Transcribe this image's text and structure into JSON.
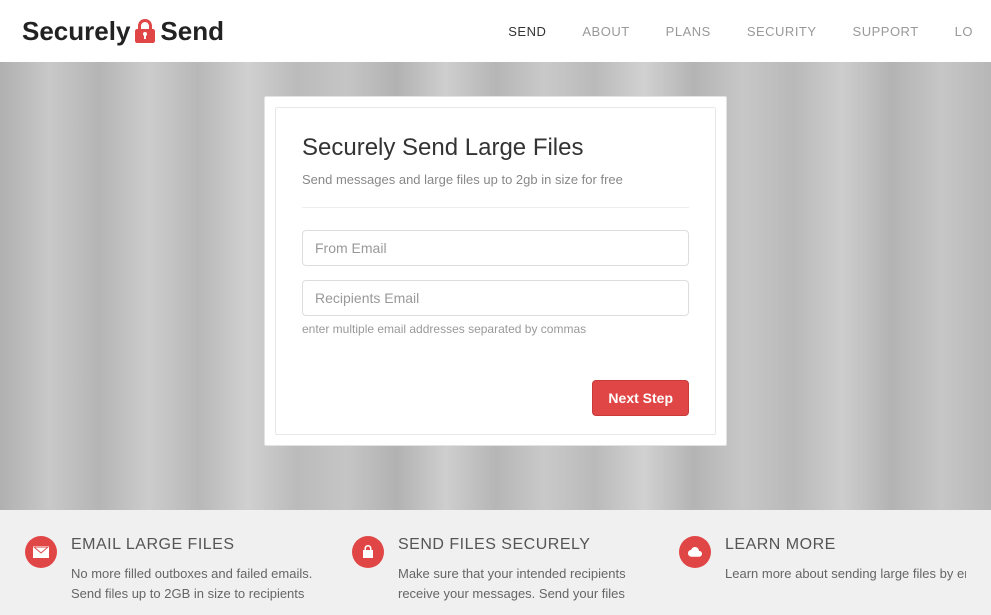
{
  "brand": {
    "part1": "Securely",
    "part2": "Send",
    "accent": "#e14646"
  },
  "nav": {
    "items": [
      {
        "label": "SEND",
        "active": true
      },
      {
        "label": "ABOUT",
        "active": false
      },
      {
        "label": "PLANS",
        "active": false
      },
      {
        "label": "SECURITY",
        "active": false
      },
      {
        "label": "SUPPORT",
        "active": false
      },
      {
        "label": "LO",
        "active": false
      }
    ]
  },
  "card": {
    "title": "Securely Send Large Files",
    "subtitle": "Send messages and large files up to 2gb in size for free",
    "from_placeholder": "From Email",
    "recipients_placeholder": "Recipients Email",
    "helper": "enter multiple email addresses separated by commas",
    "button": "Next Step"
  },
  "features": [
    {
      "icon": "envelope",
      "title": "EMAIL LARGE FILES",
      "desc": "No more filled outboxes and failed emails. Send files up to 2GB in size to recipients"
    },
    {
      "icon": "lock",
      "title": "SEND FILES SECURELY",
      "desc": "Make sure that your intended recipients receive your messages. Send your files"
    },
    {
      "icon": "cloud",
      "title": "LEARN MORE",
      "desc": "Learn more about sending large files by email and security best practices."
    }
  ]
}
